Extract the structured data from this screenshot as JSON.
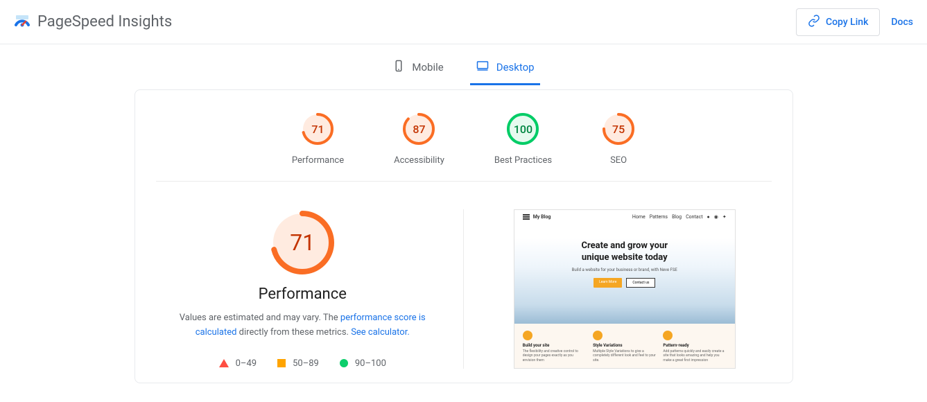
{
  "header": {
    "title": "PageSpeed Insights",
    "copy_link": "Copy Link",
    "docs": "Docs"
  },
  "tabs": {
    "mobile": "Mobile",
    "desktop": "Desktop"
  },
  "scores": {
    "performance": {
      "value": "71",
      "label": "Performance"
    },
    "accessibility": {
      "value": "87",
      "label": "Accessibility"
    },
    "best_practices": {
      "value": "100",
      "label": "Best Practices"
    },
    "seo": {
      "value": "75",
      "label": "SEO"
    }
  },
  "detail": {
    "score": "71",
    "title": "Performance",
    "desc_prefix": "Values are estimated and may vary. The ",
    "desc_link1": "performance score is calculated",
    "desc_mid": " directly from these metrics. ",
    "desc_link2": "See calculator."
  },
  "legend": {
    "fail": "0–49",
    "avg": "50–89",
    "pass": "90–100"
  },
  "preview": {
    "site_title": "My Blog",
    "nav": {
      "home": "Home",
      "patterns": "Patterns",
      "blog": "Blog",
      "contact": "Contact"
    },
    "hero_title_1": "Create and grow your",
    "hero_title_2": "unique website today",
    "hero_sub": "Build a website for your business or brand, with Neve FSE",
    "btn_primary": "Learn More",
    "btn_secondary": "Contact us",
    "features": {
      "f1": {
        "title": "Build your site",
        "desc": "The flexibility and creative control to design your pages exactly as you envision them"
      },
      "f2": {
        "title": "Style Variations",
        "desc": "Multiple Style Variations to give a completely different look and feel to your site."
      },
      "f3": {
        "title": "Pattern-ready",
        "desc": "Add patterns quickly and easily create a site that looks amazing and help you make a great first impression"
      }
    }
  }
}
